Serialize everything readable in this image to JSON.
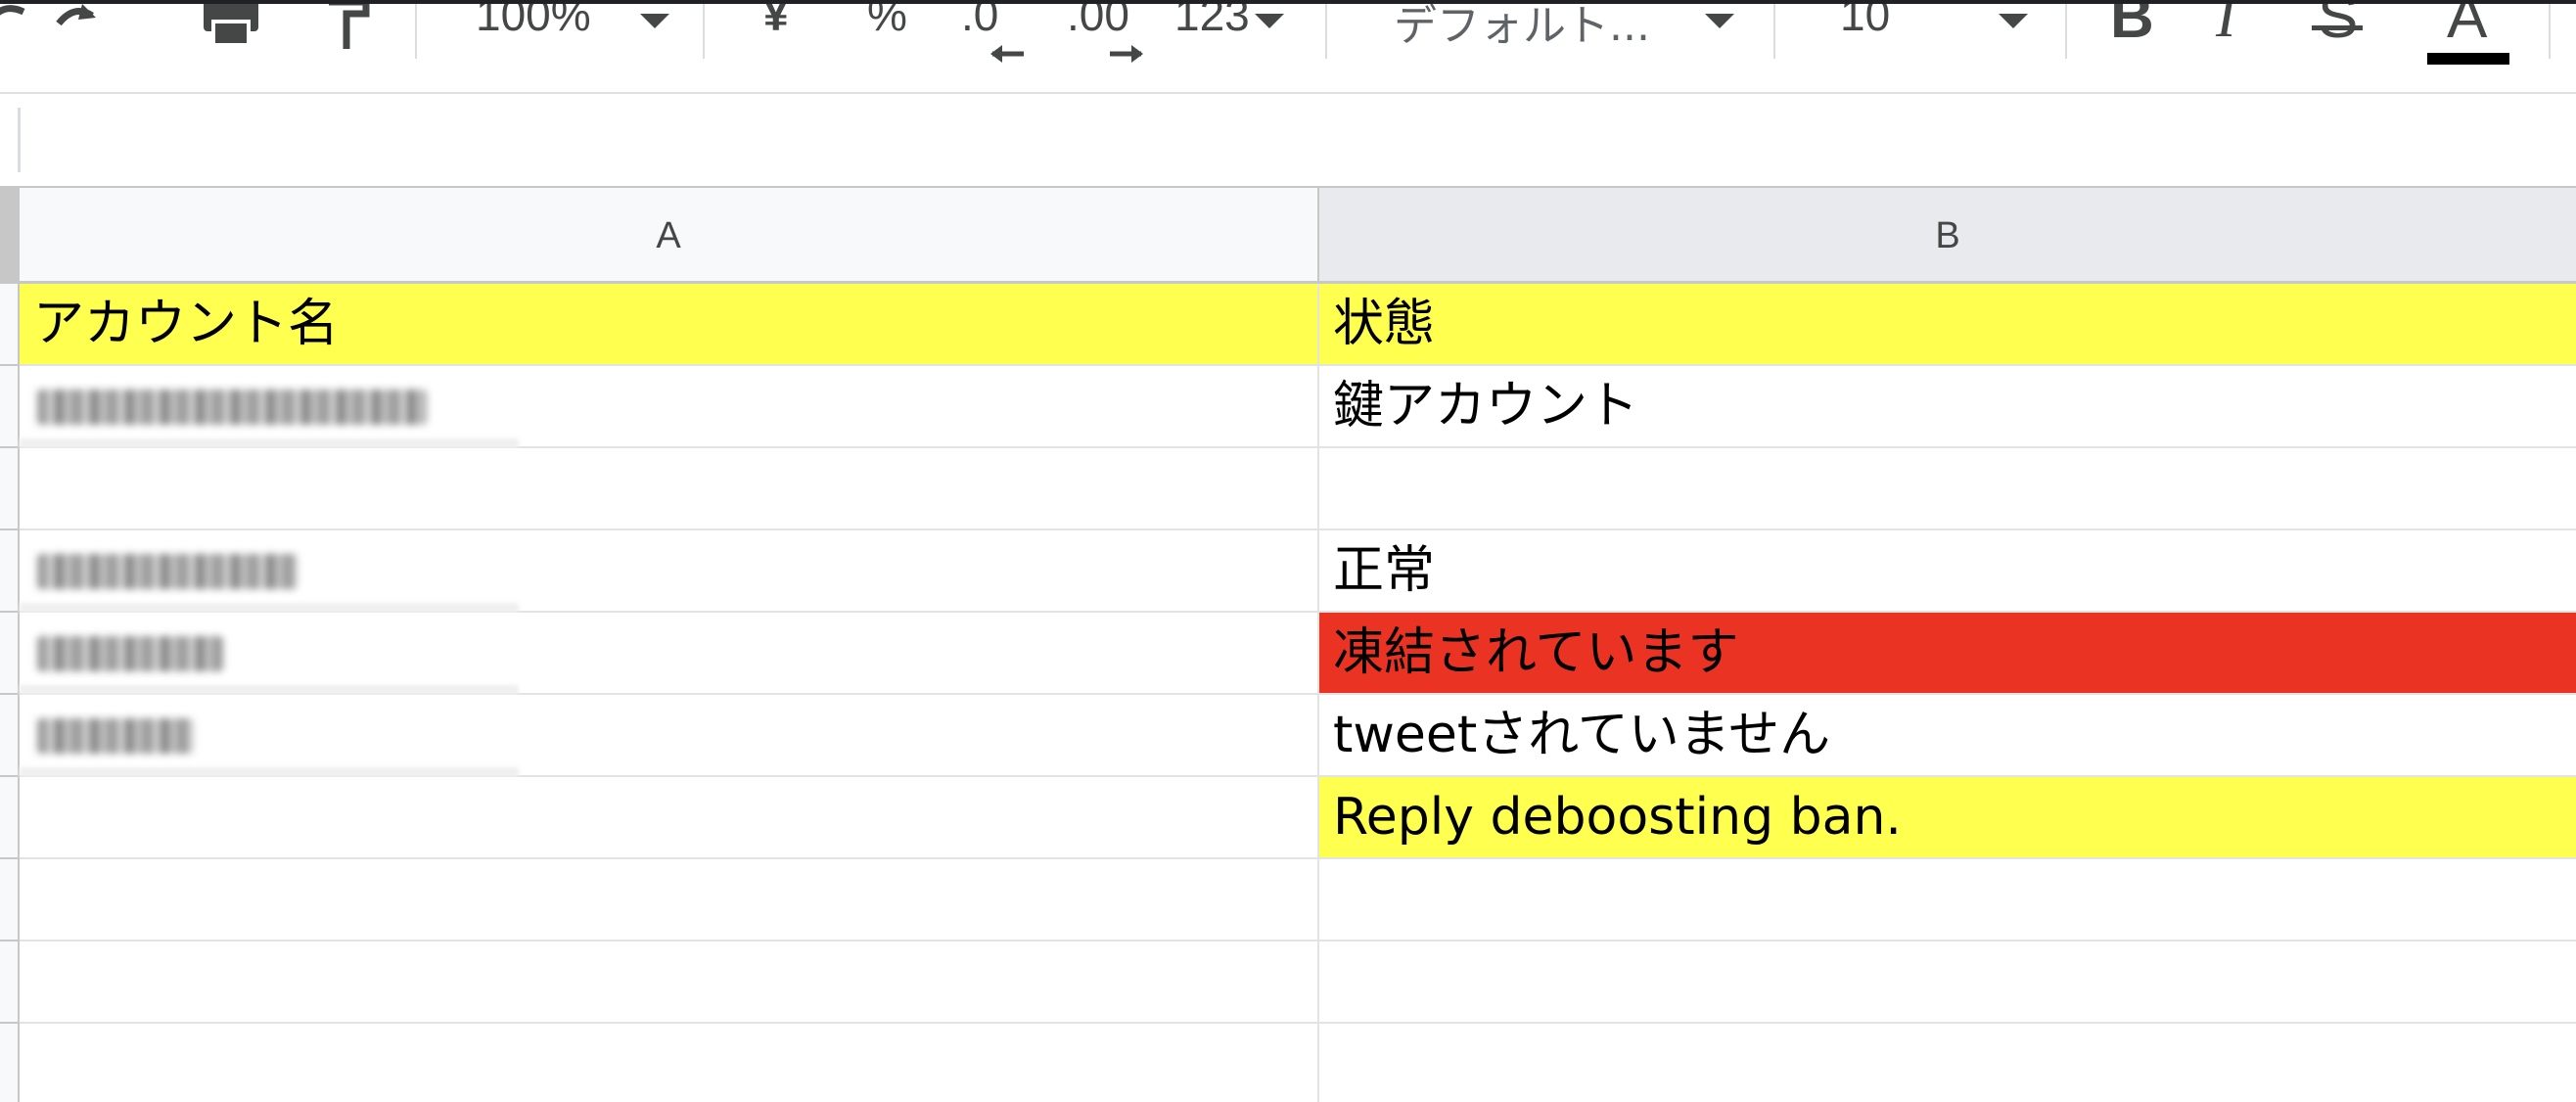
{
  "toolbar": {
    "zoom": "100%",
    "currency": "¥",
    "percent": "%",
    "decrease_decimal": ".0",
    "increase_decimal": ".00",
    "more_formats": "123",
    "font_family": "デフォルト...",
    "font_size": "10",
    "bold": "B",
    "italic": "I",
    "strikethrough": "S",
    "text_color": "A"
  },
  "columns": [
    {
      "label": "A"
    },
    {
      "label": "B"
    }
  ],
  "rows": [
    {
      "a": "アカウント名",
      "b": "状態",
      "a_redacted": false,
      "a_bg": "#ffff4f",
      "b_bg": "#ffff4f"
    },
    {
      "a": "",
      "b": "鍵アカウント",
      "a_redacted": true,
      "a_bg": "#ffffff",
      "b_bg": "#ffffff"
    },
    {
      "a": "",
      "b": "",
      "a_redacted": false,
      "a_bg": "#ffffff",
      "b_bg": "#ffffff"
    },
    {
      "a": "",
      "b": "正常",
      "a_redacted": true,
      "a_bg": "#ffffff",
      "b_bg": "#ffffff"
    },
    {
      "a": "",
      "b": "凍結されています",
      "a_redacted": true,
      "a_bg": "#ffffff",
      "b_bg": "#ea3323"
    },
    {
      "a": "",
      "b": "tweetされていません",
      "a_redacted": true,
      "a_bg": "#ffffff",
      "b_bg": "#ffffff"
    },
    {
      "a": "",
      "b": "Reply deboosting ban.",
      "a_redacted": false,
      "a_bg": "#ffffff",
      "b_bg": "#ffff4f"
    },
    {
      "a": "",
      "b": "",
      "a_redacted": false,
      "a_bg": "#ffffff",
      "b_bg": "#ffffff"
    },
    {
      "a": "",
      "b": "",
      "a_redacted": false,
      "a_bg": "#ffffff",
      "b_bg": "#ffffff"
    },
    {
      "a": "",
      "b": "",
      "a_redacted": false,
      "a_bg": "#ffffff",
      "b_bg": "#ffffff"
    }
  ],
  "colors": {
    "header_yellow": "#ffff4f",
    "frozen_red": "#ea3323"
  }
}
